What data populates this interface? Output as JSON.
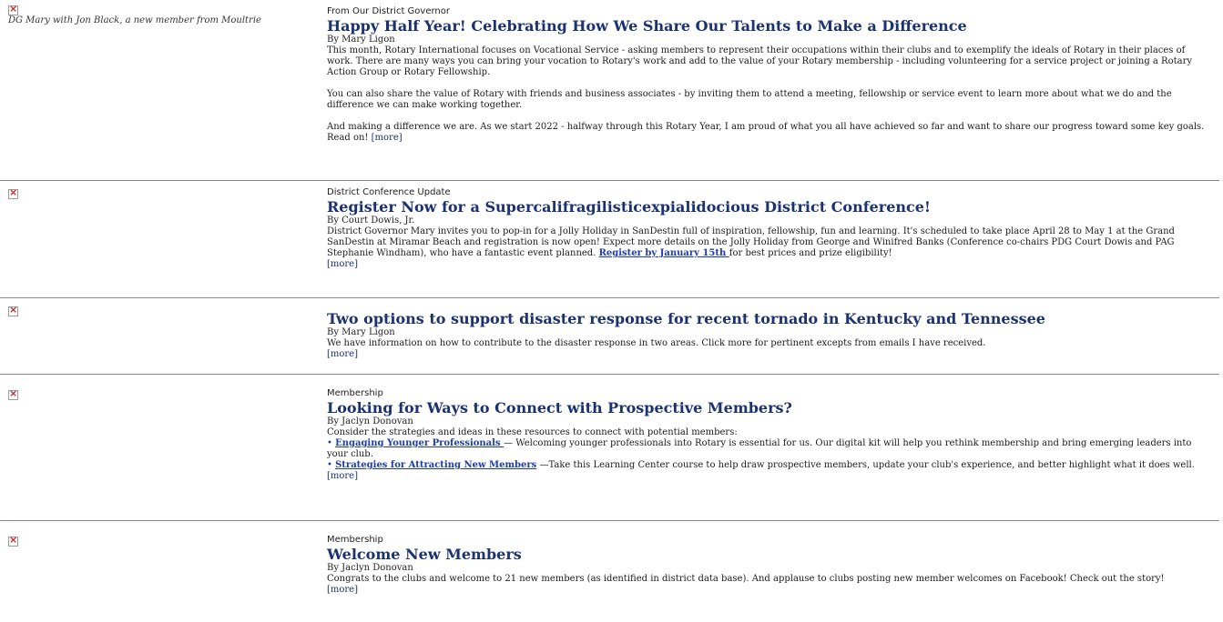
{
  "articles": [
    {
      "caption": "DG Mary with Jon Black, a new member from Moultrie",
      "section": "From Our District Governor",
      "headline": "Happy Half Year! Celebrating How We Share Our Talents to Make a Difference",
      "byline": "By Mary Ligon",
      "paragraphs": [
        "This month, Rotary International focuses on Vocational Service - asking members to represent their occupations within their clubs and to exemplify the ideals of Rotary in their places of work. There are many ways you can bring your vocation to Rotary's work and add to the value of your Rotary membership - including volunteering for a service project or joining a Rotary Action Group or Rotary Fellowship.",
        "You can also share the value of Rotary with friends and business associates - by inviting them to attend a meeting, fellowship or service event to learn more about what we do and the difference we can make working together.",
        "And making a difference we are. As we start 2022 - halfway through this Rotary Year, I am proud of what you all have achieved so far and want to share our progress toward some key goals. Read on!"
      ],
      "more": "[more]"
    },
    {
      "section": "District Conference Update",
      "headline": "Register Now for a Supercalifragilisticexpialidocious District Conference!",
      "byline": "By Court Dowis, Jr.",
      "body_before_link": "District Governor Mary invites you to pop-in for a Jolly Holiday in SanDestin full of inspiration, fellowship, fun and learning. It's scheduled to take place April 28 to May 1 at the Grand SanDestin at Miramar Beach and registration is now open! Expect more details on the Jolly Holiday from George and Winifred Banks (Conference co-chairs PDG Court Dowis and PAG Stephanie Windham), who have a fantastic event planned. ",
      "link": "Register by January 15th ",
      "body_after_link": "for best prices and prize eligibility!",
      "more": "[more]"
    },
    {
      "headline": "Two options to support disaster response for recent tornado in Kentucky and Tennessee",
      "byline": "By Mary Ligon",
      "body": "We have information on how to contribute to the disaster response in two areas. Click more for pertinent excepts from emails I have received.",
      "more": "[more]"
    },
    {
      "section": "Membership",
      "headline": "Looking for Ways to Connect with Prospective Members?",
      "byline": "By Jaclyn Donovan",
      "intro": "Consider the strategies and ideas in these resources to connect with potential members:",
      "bullets": [
        {
          "dot": "• ",
          "link": "Engaging Younger Professionals ",
          "text": " — Welcoming younger professionals into Rotary is essential for us. Our digital kit will help you rethink membership and bring emerging leaders into your club."
        },
        {
          "dot": "• ",
          "link": "Strategies for Attracting New Members",
          "text": " —Take this Learning Center course to help draw prospective members, update your club's experience, and better highlight what it does well."
        }
      ],
      "more": "[more]"
    },
    {
      "section": "Membership",
      "headline": "Welcome New Members",
      "byline": "By Jaclyn Donovan",
      "body": "Congrats to the clubs and welcome to 21 new members (as identified in district data base). And applause to clubs posting new member welcomes on Facebook! Check out the story!",
      "more": "[more]"
    }
  ],
  "colors": {
    "headline": "#1b3272",
    "link": "#1c3bb0",
    "broken_image_x": "#d42020",
    "divider": "#8a8a8a"
  }
}
